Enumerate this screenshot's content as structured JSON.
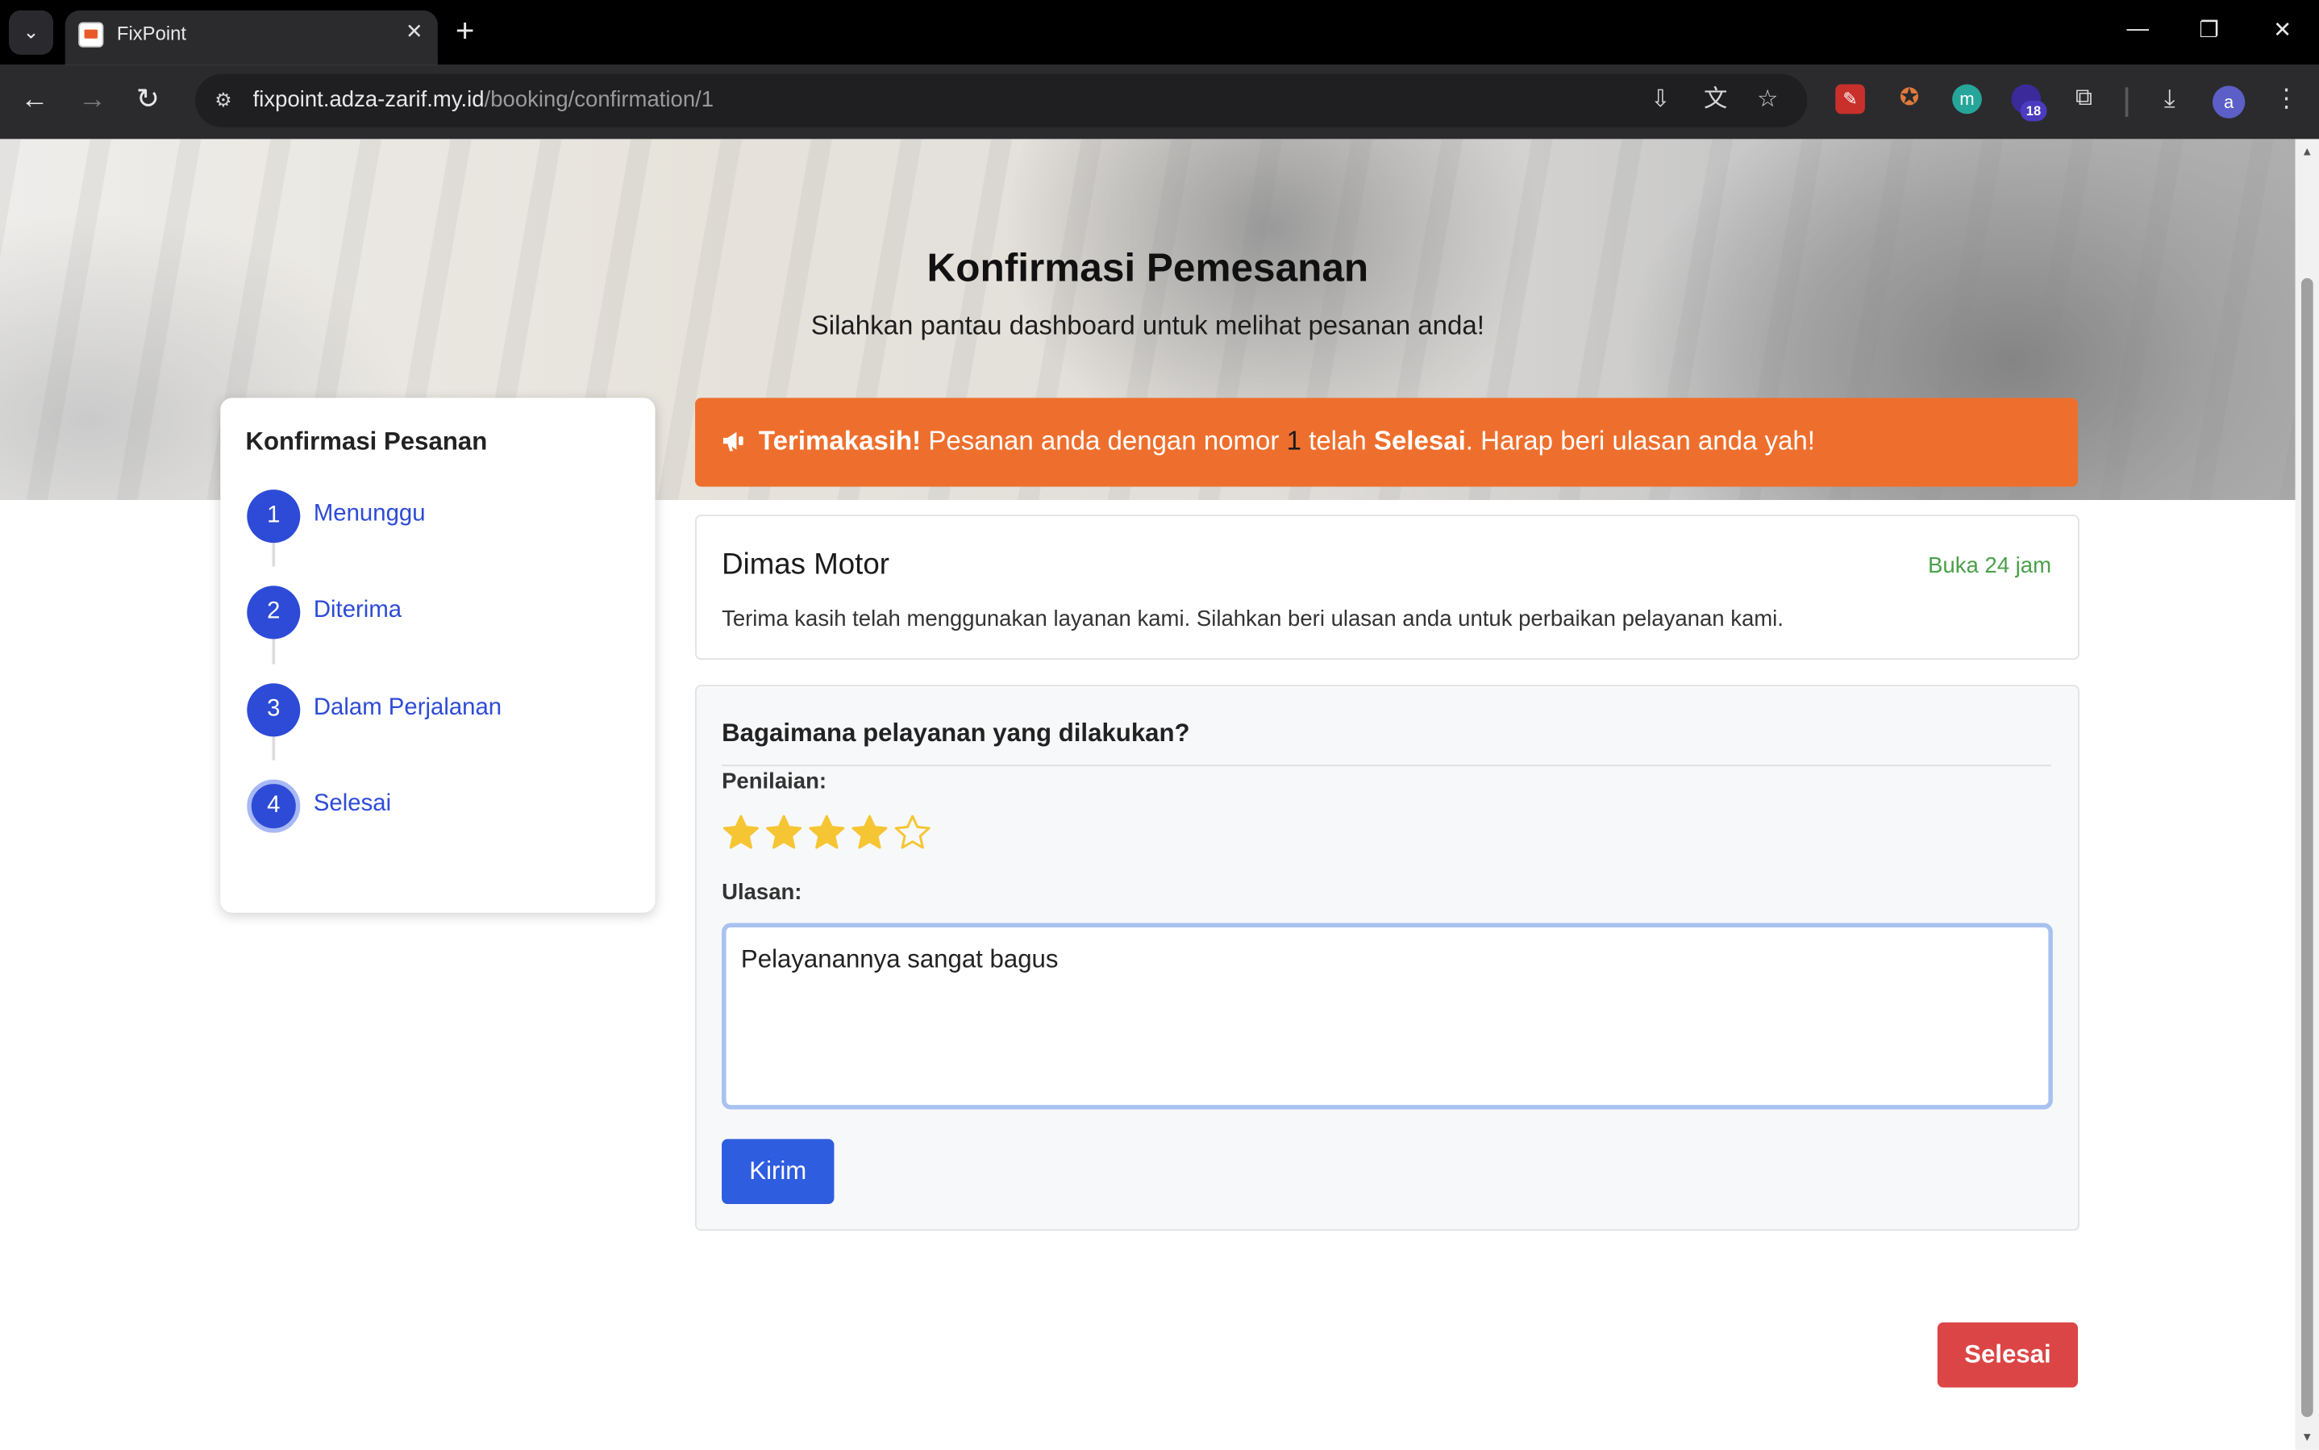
{
  "browser": {
    "tab_title": "FixPoint",
    "url_host": "fixpoint.adza-zarif.my.id",
    "url_path": "/booking/confirmation/1",
    "extension_badge": "18",
    "profile_initial": "a"
  },
  "hero": {
    "title": "Konfirmasi Pemesanan",
    "subtitle": "Silahkan pantau dashboard untuk melihat pesanan anda!"
  },
  "steps": {
    "title": "Konfirmasi Pesanan",
    "items": [
      {
        "num": "1",
        "label": "Menunggu"
      },
      {
        "num": "2",
        "label": "Diterima"
      },
      {
        "num": "3",
        "label": "Dalam Perjalanan"
      },
      {
        "num": "4",
        "label": "Selesai"
      }
    ],
    "active_index": 3
  },
  "alert": {
    "strong": "Terimakasih!",
    "part1": " Pesanan anda dengan nomor ",
    "order_number": "1",
    "part2": " telah ",
    "status": "Selesai",
    "part3": ". Harap beri ulasan anda yah!",
    "color": "#ee6f2d"
  },
  "shop": {
    "name": "Dimas Motor",
    "hours": "Buka 24 jam",
    "description": "Terima kasih telah menggunakan layanan kami. Silahkan beri ulasan anda untuk perbaikan pelayanan kami."
  },
  "review": {
    "question": "Bagaimana pelayanan yang dilakukan?",
    "rating_label": "Penilaian:",
    "rating": 4,
    "rating_max": 5,
    "review_label": "Ulasan:",
    "review_value": "Pelayanannya sangat bagus",
    "submit_label": "Kirim"
  },
  "finish_button": "Selesai",
  "colors": {
    "primary": "#2d4bd6",
    "star": "#f5c533",
    "success": "#4aa04a",
    "danger": "#dc4545"
  }
}
